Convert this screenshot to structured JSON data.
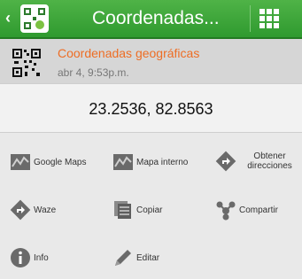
{
  "topbar": {
    "back_glyph": "‹",
    "title": "Coordenadas...",
    "app_icon": "qr-droid-app-icon",
    "menu_icon": "grid-menu-icon"
  },
  "header": {
    "icon": "qr-code-icon",
    "title": "Coordenadas geográficas",
    "timestamp": "abr 4, 9:53p.m."
  },
  "coordinates": "23.2536, 82.8563",
  "actions": {
    "google_maps": {
      "label": "Google Maps",
      "icon": "map-icon"
    },
    "mapa_interno": {
      "label": "Mapa interno",
      "icon": "map-icon"
    },
    "obtener_direcciones": {
      "label": "Obtener direcciones",
      "icon": "directions-icon"
    },
    "waze": {
      "label": "Waze",
      "icon": "directions-icon"
    },
    "copiar": {
      "label": "Copiar",
      "icon": "copy-icon"
    },
    "compartir": {
      "label": "Compartir",
      "icon": "share-icon"
    },
    "info": {
      "label": "Info",
      "icon": "info-icon"
    },
    "editar": {
      "label": "Editar",
      "icon": "pencil-icon"
    }
  },
  "colors": {
    "topbar_green": "#3aa53a",
    "title_orange": "#ee6d24",
    "background": "#e9e9e9"
  }
}
